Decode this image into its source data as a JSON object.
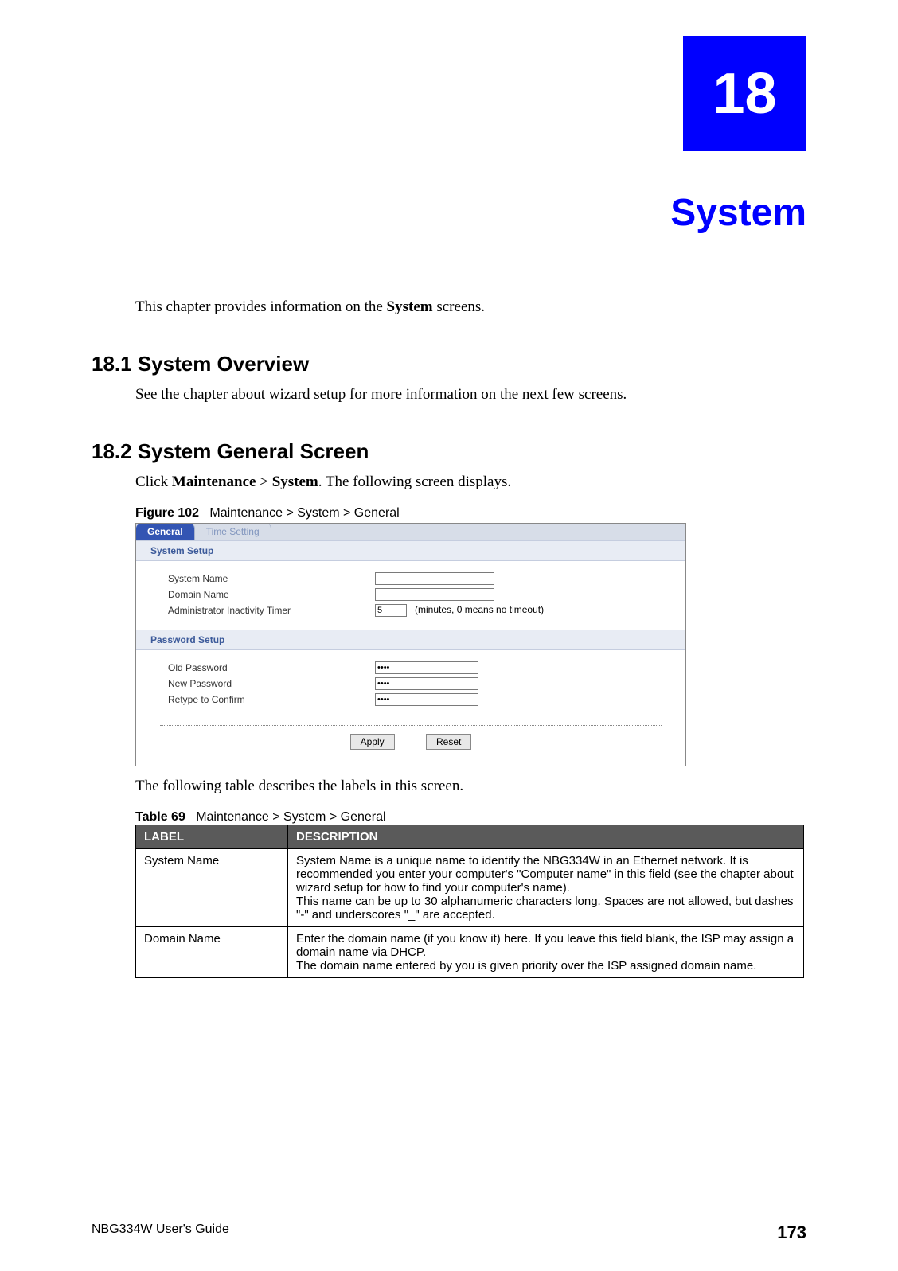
{
  "chapter": {
    "number": "18",
    "title": "System"
  },
  "intro_prefix": "This chapter provides information on the ",
  "intro_bold": "System",
  "intro_suffix": " screens.",
  "s1": {
    "heading": "18.1  System Overview",
    "body": "See the chapter about wizard setup for more information on the next few screens."
  },
  "s2": {
    "heading": "18.2  System General Screen",
    "body_prefix": "Click ",
    "body_b1": "Maintenance",
    "body_mid": " > ",
    "body_b2": "System",
    "body_suffix": ". The following screen displays."
  },
  "figure": {
    "label": "Figure 102",
    "caption": "Maintenance > System > General"
  },
  "screenshot": {
    "tabs": {
      "active": "General",
      "inactive": "Time Setting"
    },
    "panel1": {
      "title": "System Setup",
      "rows": {
        "sysname": {
          "label": "System Name",
          "value": ""
        },
        "domain": {
          "label": "Domain Name",
          "value": ""
        },
        "timer": {
          "label": "Administrator Inactivity Timer",
          "value": "5",
          "hint": "(minutes, 0 means no timeout)"
        }
      }
    },
    "panel2": {
      "title": "Password Setup",
      "rows": {
        "oldpw": {
          "label": "Old Password",
          "value": "****"
        },
        "newpw": {
          "label": "New Password",
          "value": "****"
        },
        "retype": {
          "label": "Retype to Confirm",
          "value": "****"
        }
      }
    },
    "buttons": {
      "apply": "Apply",
      "reset": "Reset"
    }
  },
  "table_intro": "The following table describes the labels in this screen.",
  "table": {
    "label": "Table 69",
    "caption": "Maintenance > System > General",
    "headers": {
      "c1": "LABEL",
      "c2": "DESCRIPTION"
    },
    "rows": [
      {
        "label": "System Name",
        "desc1": "System Name is a unique name to identify the NBG334W in an Ethernet network. It is recommended you enter your computer's \"Computer name\" in this field (see the chapter about wizard setup for how to find your computer's name).",
        "desc2": "This name can be up to 30 alphanumeric characters long. Spaces are not allowed, but dashes \"-\" and underscores \"_\" are accepted."
      },
      {
        "label": "Domain Name",
        "desc1": "Enter the domain name (if you know it) here. If you leave this field blank, the ISP may assign a domain name via DHCP.",
        "desc2": "The domain name entered by you is given priority over the ISP assigned domain name."
      }
    ]
  },
  "footer": {
    "guide": "NBG334W User's Guide",
    "page": "173"
  }
}
